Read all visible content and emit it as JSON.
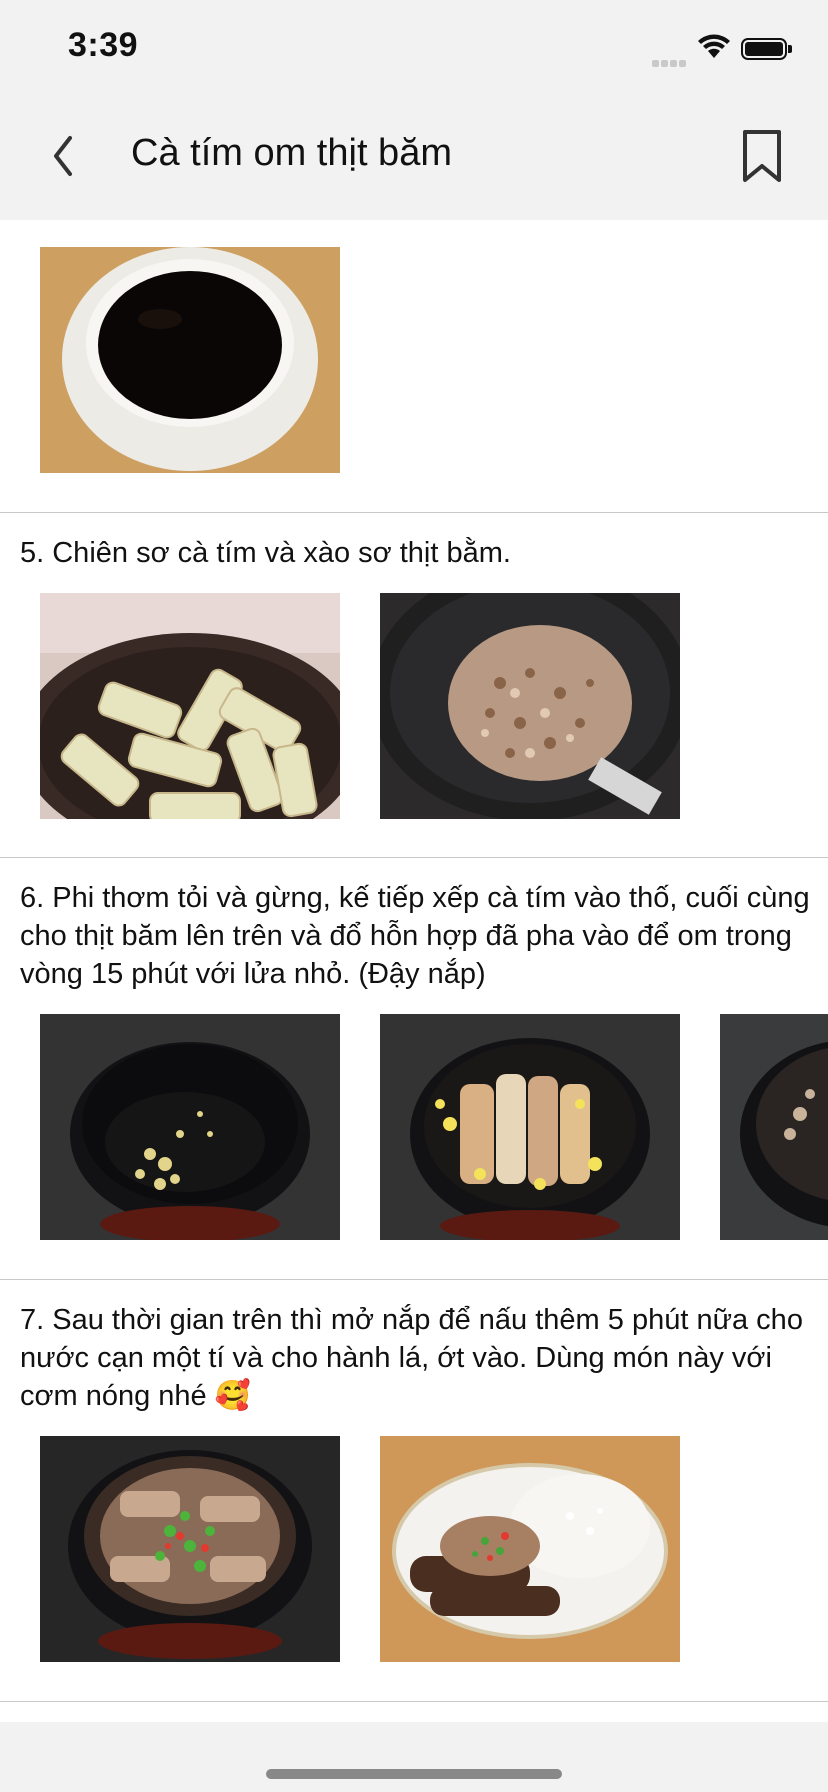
{
  "status_bar": {
    "time": "3:39"
  },
  "nav": {
    "title": "Cà tím om thịt băm"
  },
  "steps": [
    {
      "photos": [
        {
          "name": "sauce-bowl"
        }
      ]
    },
    {
      "text": "5. Chiên sơ cà tím và xào sơ thịt bằm.",
      "photos": [
        {
          "name": "fried-eggplant"
        },
        {
          "name": "stir-fried-pork"
        }
      ]
    },
    {
      "text": "6. Phi thơm tỏi và gừng, kế tiếp xếp cà tím vào thố, cuối cùng cho thịt băm lên trên và đổ hỗn hợp đã pha vào để om trong vòng 15 phút với lửa nhỏ. (Đậy nắp)",
      "photos": [
        {
          "name": "garlic-ginger-pot"
        },
        {
          "name": "eggplant-in-pot"
        },
        {
          "name": "pot-partial"
        }
      ]
    },
    {
      "text": "7. Sau thời gian trên thì mở nắp để nấu thêm 5 phút nữa cho nước cạn một tí và cho hành lá, ớt vào. Dùng món này với cơm nóng nhé 🥰",
      "photos": [
        {
          "name": "finished-pot"
        },
        {
          "name": "plated-with-rice"
        }
      ]
    }
  ],
  "colors": {
    "bar_bg": "#f2f2f2",
    "divider": "#c8c8c8",
    "text": "#111111"
  }
}
